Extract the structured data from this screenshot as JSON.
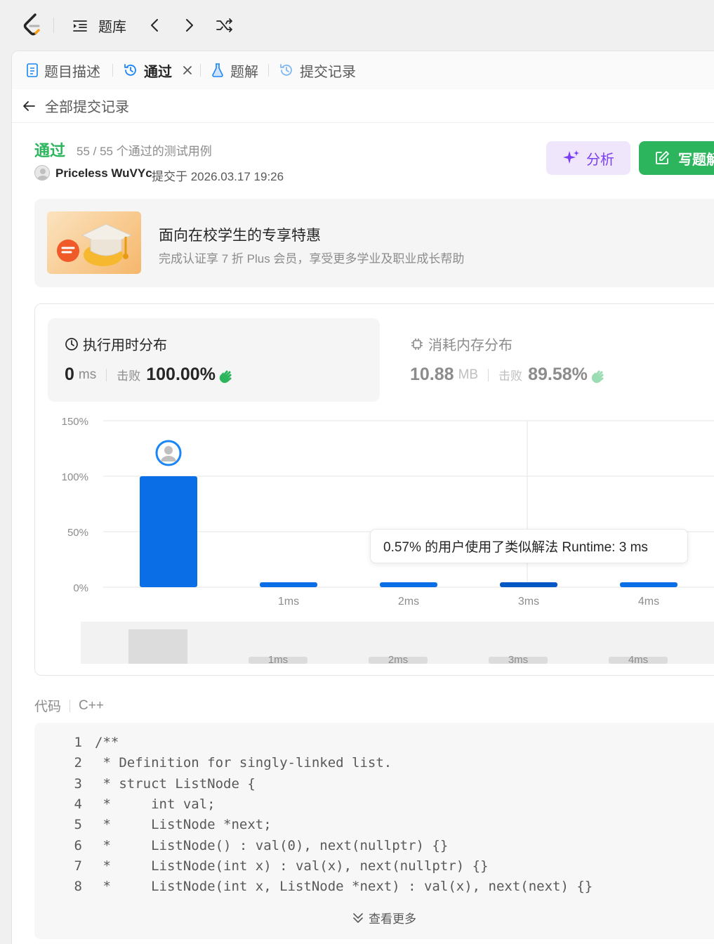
{
  "topbar": {
    "problem_list_label": "题库"
  },
  "tabs": [
    {
      "label": "题目描述"
    },
    {
      "label": "通过"
    },
    {
      "label": "题解"
    },
    {
      "label": "提交记录"
    }
  ],
  "breadcrumb": {
    "label": "全部提交记录"
  },
  "result": {
    "status": "通过",
    "cases": "55 / 55 个通过的测试用例",
    "user": "Priceless WuVYc",
    "submitted": "提交于 2026.03.17 19:26",
    "analyze_label": "分析",
    "write_label": "写题解"
  },
  "promo": {
    "title": "面向在校学生的专享特惠",
    "subtitle": "完成认证享 7 折 Plus 会员，享受更多学业及职业成长帮助"
  },
  "stats": {
    "runtime": {
      "title": "执行用时分布",
      "value": "0",
      "unit": "ms",
      "beat_label": "击败",
      "beat": "100.00%"
    },
    "memory": {
      "title": "消耗内存分布",
      "value": "10.88",
      "unit": "MB",
      "beat_label": "击败",
      "beat": "89.58%"
    }
  },
  "chart_data": {
    "type": "bar",
    "categories": [
      "0ms",
      "1ms",
      "2ms",
      "3ms",
      "4ms"
    ],
    "x_tick_labels": [
      "",
      "1ms",
      "2ms",
      "3ms",
      "4ms"
    ],
    "values": [
      100.0,
      0.57,
      0.57,
      0.57,
      0.57
    ],
    "ylim": [
      0,
      150
    ],
    "yticks": [
      "0%",
      "50%",
      "100%",
      "150%"
    ],
    "grid": true,
    "bar_color": "#0a6fe6",
    "highlight_category": "0ms",
    "tooltip": "0.57% 的用户使用了类似解法 Runtime: 3 ms",
    "minimap_labels": [
      "",
      "1ms",
      "2ms",
      "3ms",
      "4ms"
    ]
  },
  "code": {
    "label": "代码",
    "language": "C++",
    "lines": [
      "/**",
      " * Definition for singly-linked list.",
      " * struct ListNode {",
      " *     int val;",
      " *     ListNode *next;",
      " *     ListNode() : val(0), next(nullptr) {}",
      " *     ListNode(int x) : val(x), next(nullptr) {}",
      " *     ListNode(int x, ListNode *next) : val(x), next(next) {}"
    ],
    "more_label": "查看更多"
  },
  "colors": {
    "accent": "#0a6fe6",
    "success": "#2db55d",
    "analyze": "#7a3ff0"
  }
}
